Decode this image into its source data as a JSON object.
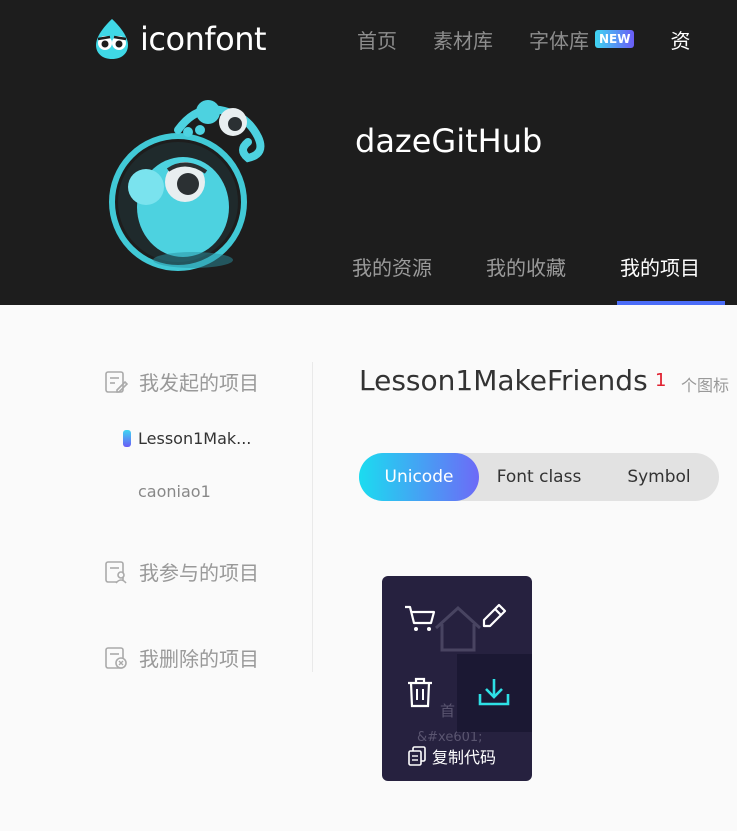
{
  "header": {
    "logo_text": "iconfont",
    "nav": [
      {
        "label": "首页"
      },
      {
        "label": "素材库"
      },
      {
        "label": "字体库",
        "badge": "NEW"
      },
      {
        "label": "资"
      }
    ],
    "username": "dazeGitHub",
    "tabs": [
      {
        "label": "我的资源"
      },
      {
        "label": "我的收藏"
      },
      {
        "label": "我的项目",
        "active": true
      }
    ]
  },
  "sidebar": {
    "initiated_label": "我发起的项目",
    "projects": [
      {
        "label": "Lesson1Mak...",
        "active": true
      },
      {
        "label": "caoniao1"
      }
    ],
    "participated_label": "我参与的项目",
    "deleted_label": "我删除的项目"
  },
  "project": {
    "title": "Lesson1MakeFriends",
    "icon_count": "1",
    "icon_count_label": "个图标"
  },
  "code_tabs": [
    {
      "label": "Unicode",
      "active": true
    },
    {
      "label": "Font class"
    },
    {
      "label": "Symbol"
    }
  ],
  "icon_card": {
    "icon_name_partial": "首",
    "code_partial": "&#xe601;",
    "copy_label": "复制代码",
    "icons": [
      "home-icon",
      "cart-icon",
      "edit-icon",
      "trash-icon",
      "download-icon",
      "copy-icon"
    ]
  },
  "colors": {
    "header_bg": "#1d1d1d",
    "accent_gradient_start": "#1bdcf0",
    "accent_gradient_end": "#6d6af7",
    "tab_underline": "#4a6cf7",
    "count_red": "#e0202f",
    "card_bg": "#26213f"
  }
}
